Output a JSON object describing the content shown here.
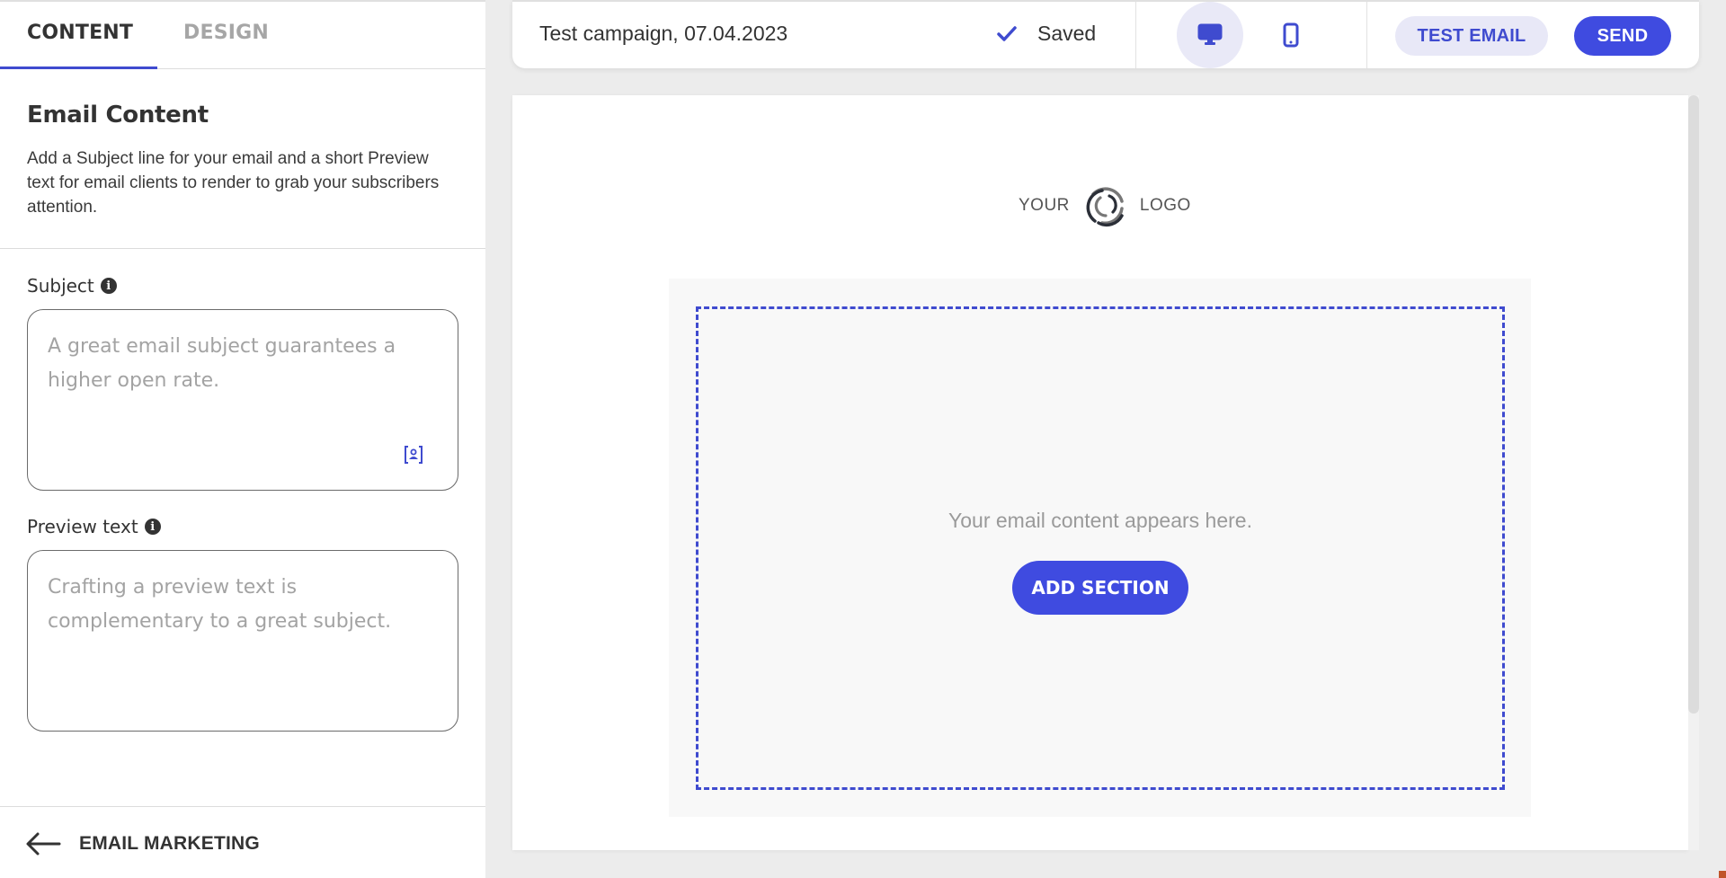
{
  "sidebar": {
    "tabs": [
      {
        "label": "CONTENT",
        "active": true
      },
      {
        "label": "DESIGN",
        "active": false
      }
    ],
    "section": {
      "title": "Email Content",
      "description": "Add a Subject line for your email and a short Preview text for email clients to render to grab your subscribers attention."
    },
    "subject": {
      "label": "Subject",
      "placeholder": "A great email subject guarantees a higher open rate.",
      "value": "",
      "info_icon": "info-icon",
      "personalize_icon": "personalize-icon"
    },
    "preview": {
      "label": "Preview text",
      "placeholder": "Crafting a preview text is complementary to a great subject.",
      "value": "",
      "info_icon": "info-icon"
    },
    "back": {
      "label": "EMAIL MARKETING",
      "icon": "arrow-left-icon"
    }
  },
  "topbar": {
    "campaign_name": "Test campaign, 07.04.2023",
    "status": "Saved",
    "status_icon": "check-icon",
    "devices": [
      {
        "name": "desktop",
        "icon": "desktop-icon",
        "active": true
      },
      {
        "name": "mobile",
        "icon": "mobile-icon",
        "active": false
      }
    ],
    "test_email_label": "TEST EMAIL",
    "send_label": "SEND"
  },
  "canvas": {
    "logo_left": "YOUR",
    "logo_right": "LOGO",
    "placeholder": "Your email content appears here.",
    "add_section_label": "ADD SECTION"
  },
  "colors": {
    "accent": "#3f4be0",
    "accent_light": "#e8e8f7",
    "text": "#333333",
    "muted": "#a3a3a3"
  }
}
